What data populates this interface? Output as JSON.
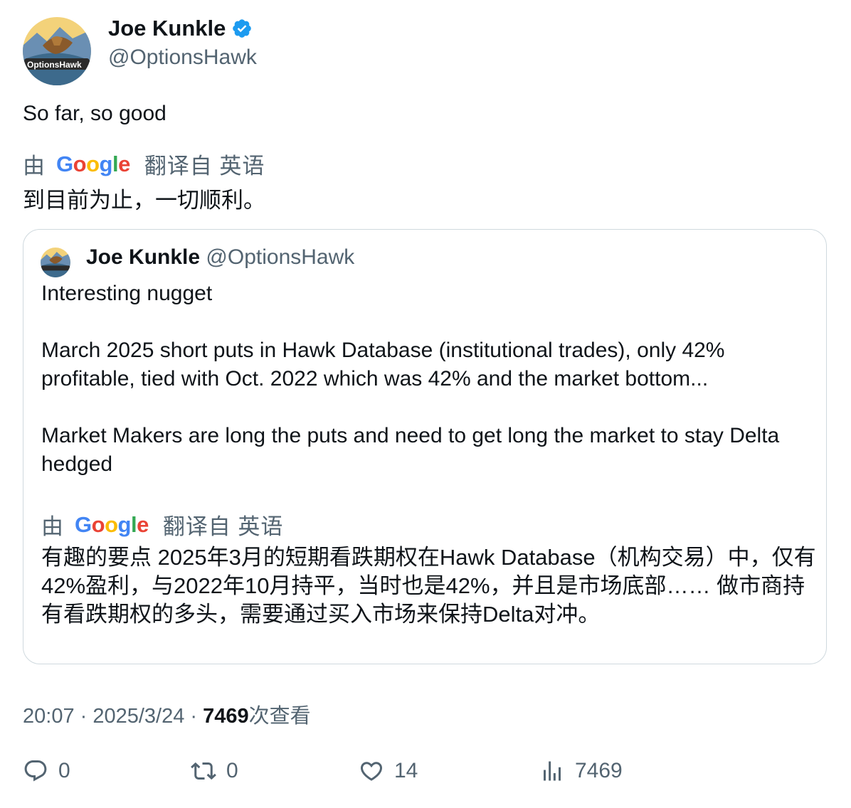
{
  "author": {
    "name": "Joe Kunkle",
    "handle": "@OptionsHawk",
    "avatar_text": "OptionsHawk"
  },
  "tweet": {
    "text": "So far, so good",
    "translation_by": "由",
    "translation_google": "Google",
    "translation_from": "翻译自 英语",
    "translated_text": "到目前为止，一切顺利。"
  },
  "quote": {
    "name": "Joe Kunkle",
    "handle": "@OptionsHawk",
    "paragraphs": [
      "Interesting nugget",
      "March 2025 short puts in Hawk Database (institutional trades), only 42% profitable, tied with Oct. 2022 which was 42% and the market bottom...",
      "Market Makers are long the puts and need to get long the market to stay Delta hedged"
    ],
    "translation_by": "由",
    "translation_google": "Google",
    "translation_from": "翻译自 英语",
    "translated_text": "有趣的要点 2025年3月的短期看跌期权在Hawk Database（机构交易）中，仅有42%盈利，与2022年10月持平，当时也是42%，并且是市场底部…… 做市商持有看跌期权的多头，需要通过买入市场来保持Delta对冲。"
  },
  "meta": {
    "time": "20:07",
    "sep": " · ",
    "date": "2025/3/24",
    "views_count": "7469",
    "views_label": "次查看"
  },
  "actions": {
    "reply": "0",
    "retweet": "0",
    "like": "14",
    "views": "7469"
  },
  "icons": {
    "verified": "verified-badge-icon",
    "reply": "reply-icon",
    "retweet": "retweet-icon",
    "like": "heart-icon",
    "views": "analytics-icon"
  },
  "colors": {
    "verified": "#1d9bf0",
    "secondary_text": "#536471",
    "border": "#cfd9de"
  }
}
